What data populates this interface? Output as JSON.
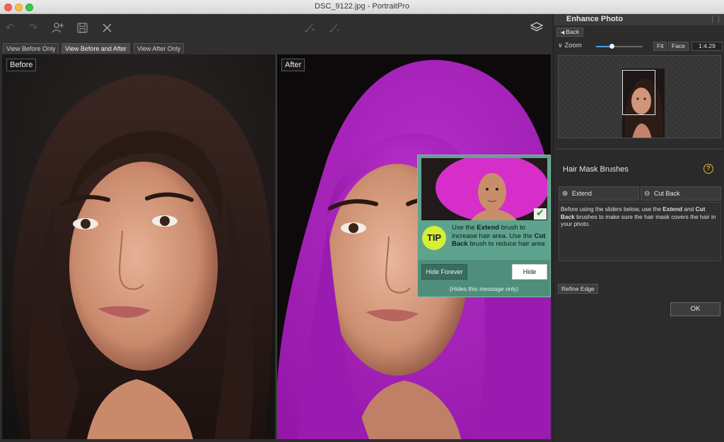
{
  "window": {
    "title": "DSC_9122.jpg - PortraitPro"
  },
  "toolbar": {
    "icons": [
      "undo-icon",
      "redo-icon",
      "add-person-icon",
      "save-icon",
      "close-icon",
      "brush-extend-icon",
      "brush-cutback-icon",
      "layers-icon"
    ]
  },
  "view_tabs": [
    "View Before Only",
    "View Before and After",
    "View After Only"
  ],
  "active_view_tab": "View Before and After",
  "panes": {
    "before_label": "Before",
    "after_label": "After"
  },
  "tip": {
    "badge": "TIP",
    "text_parts": [
      "Use the ",
      "Extend",
      " brush to increase hair area. Use the ",
      "Cut Back",
      " brush to reduce hair area"
    ],
    "hide_forever_label": "Hide Forever",
    "hide_label": "Hide",
    "note": "(Hides this message only)"
  },
  "right_panel": {
    "title": "Enhance Photo",
    "back_label": "Back",
    "zoom": {
      "label": "Zoom",
      "slider_fraction": 0.33,
      "fit_label": "Fit",
      "face_label": "Face",
      "value": "1:4.29"
    },
    "hair_mask": {
      "title": "Hair Mask Brushes",
      "help": "?",
      "extend_label": "Extend",
      "cutback_label": "Cut Back",
      "instructions_parts": [
        "Before using the sliders below, use the ",
        "Extend",
        " and ",
        "Cut Back",
        " brushes to make sure the hair mask covers the hair in your photo."
      ]
    },
    "refine_edge_label": "Refine Edge",
    "ok_label": "OK"
  },
  "colors": {
    "hair_mask": "#a51fb8",
    "tip_bg": "#5ea38e",
    "tip_badge": "#d6ee34",
    "help_icon": "#e6b422",
    "zoom_slider": "#48a0e6"
  }
}
